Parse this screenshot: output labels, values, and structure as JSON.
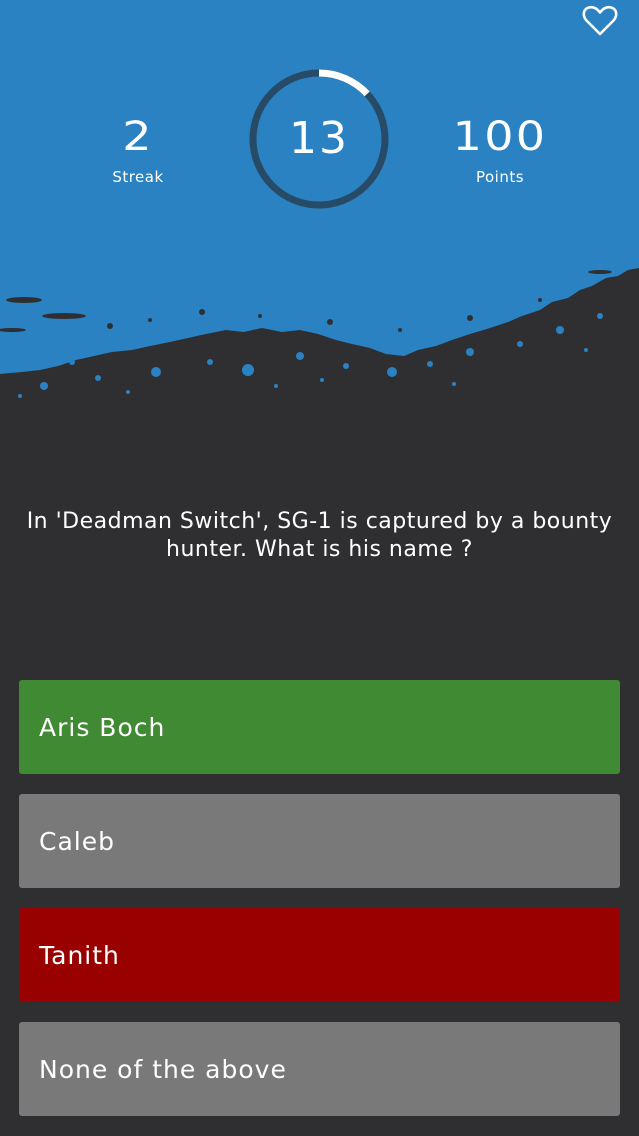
{
  "header": {
    "favorite_icon": "heart-outline-icon",
    "colors": {
      "header_blue": "#2a82c2",
      "timer_ring_dark": "#274a66",
      "timer_ring_progress": "#ffffff"
    }
  },
  "stats": {
    "streak": {
      "value": "2",
      "label": "Streak"
    },
    "timer": {
      "value": "13",
      "progress": 0.13
    },
    "points": {
      "value": "100",
      "label": "Points"
    }
  },
  "question": {
    "text": "In 'Deadman Switch', SG-1 is captured by a bounty hunter. What is his name ?"
  },
  "answers": [
    {
      "label": "Aris Boch",
      "state": "correct",
      "color": "#3f8a32"
    },
    {
      "label": "Caleb",
      "state": "neutral",
      "color": "#7a797a"
    },
    {
      "label": "Tanith",
      "state": "wrong",
      "color": "#990000"
    },
    {
      "label": "None of the above",
      "state": "neutral",
      "color": "#7a797a"
    }
  ],
  "colors": {
    "background": "#2f2f31"
  }
}
